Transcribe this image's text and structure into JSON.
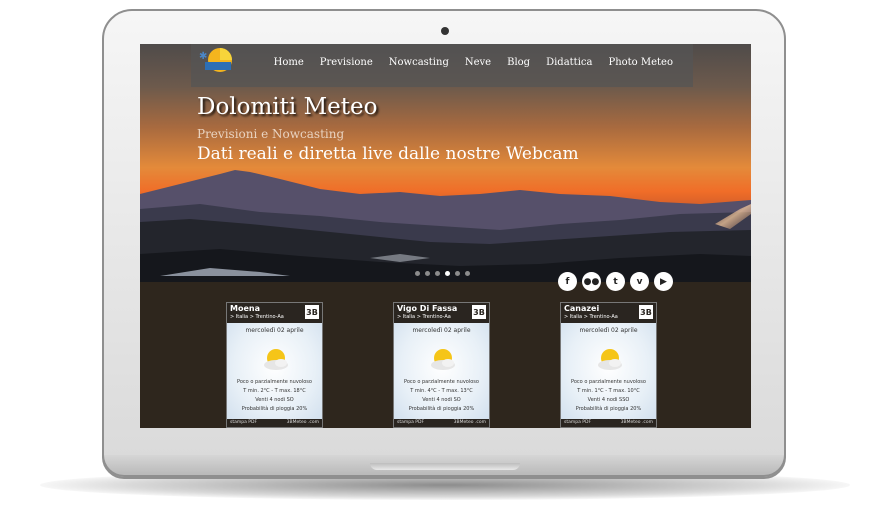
{
  "site": {
    "title": "Dolomiti Meteo",
    "subtitle": "Previsioni e Nowcasting",
    "tagline": "Dati reali e diretta live dalle nostre Webcam"
  },
  "nav": {
    "items": [
      {
        "label": "Home"
      },
      {
        "label": "Previsione"
      },
      {
        "label": "Nowcasting"
      },
      {
        "label": "Neve"
      },
      {
        "label": "Blog"
      },
      {
        "label": "Didattica"
      },
      {
        "label": "Photo Meteo"
      }
    ]
  },
  "slider": {
    "total": 6,
    "active": 3
  },
  "social": [
    "facebook-icon",
    "flickr-icon",
    "twitter-icon",
    "vimeo-icon",
    "youtube-icon"
  ],
  "widgets": [
    {
      "city": "Moena",
      "path": ">   Italia   >   Trentino-Aa",
      "badge": "3B",
      "date": "mercoledì 02 aprile",
      "condition": "Poco o parzialmente nuvoloso",
      "temps": "T min. 2°C - T max. 18°C",
      "wind": "Venti 4 nodi SO",
      "rain": "Probabilità di pioggia 20%",
      "footer_left": "stampa PDF",
      "footer_right": "3BMeteo .com"
    },
    {
      "city": "Vigo Di Fassa",
      "path": ">   Italia   >   Trentino-Aa",
      "badge": "3B",
      "date": "mercoledì 02 aprile",
      "condition": "Poco o parzialmente nuvoloso",
      "temps": "T min. 4°C - T max. 13°C",
      "wind": "Venti 4 nodi SO",
      "rain": "Probabilità di pioggia 20%",
      "footer_left": "stampa PDF",
      "footer_right": "3BMeteo .com"
    },
    {
      "city": "Canazei",
      "path": ">   Italia   >   Trentino-Aa",
      "badge": "3B",
      "date": "mercoledì 02 aprile",
      "condition": "Poco o parzialmente nuvoloso",
      "temps": "T min. 1°C - T max. 10°C",
      "wind": "Venti 4 nodi SSO",
      "rain": "Probabilità di pioggia 20%",
      "footer_left": "stampa PDF",
      "footer_right": "3BMeteo .com"
    }
  ]
}
